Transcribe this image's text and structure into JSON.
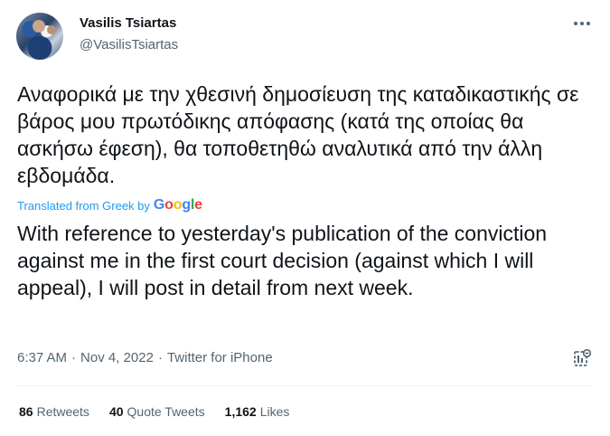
{
  "tweet": {
    "author_name": "Vasilis Tsiartas",
    "author_handle": "@VasilisTsiartas",
    "original_text": "Αναφορικά με την χθεσινή δημοσίευση της καταδικαστικής σε βάρος μου πρωτόδικης απόφασης (κατά της οποίας θα ασκήσω έφεση), θα τοποθετηθώ αναλυτικά από την άλλη εβδομάδα.",
    "translated_label": "Translated from Greek by",
    "google_logo": {
      "G": "G",
      "o1": "o",
      "o2": "o",
      "g": "g",
      "l": "l",
      "e": "e"
    },
    "translation_text": "With reference to yesterday's publication of the conviction against me in the first court decision (against which I will appeal), I will post in detail from next week.",
    "time": "6:37 AM",
    "separator": "·",
    "date": "Nov 4, 2022",
    "source": "Twitter for iPhone"
  },
  "stats": {
    "retweets_count": "86",
    "retweets_label": "Retweets",
    "quotes_count": "40",
    "quotes_label": "Quote Tweets",
    "likes_count": "1,162",
    "likes_label": "Likes"
  },
  "colors": {
    "text_primary": "#0f1419",
    "text_secondary": "#536471",
    "link": "#1d9bf0",
    "divider": "#eff3f4"
  },
  "icons": {
    "more": "more-options-icon",
    "analytics": "tweet-analytics-icon"
  }
}
